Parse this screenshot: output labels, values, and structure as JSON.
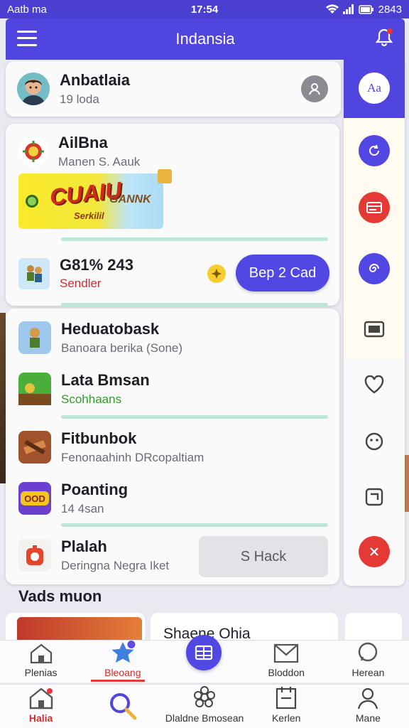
{
  "status": {
    "left": "Aatb ma",
    "time": "17:54",
    "battery": "2843"
  },
  "header": {
    "title": "Indansia"
  },
  "profile": {
    "name": "Anbatlaia",
    "sub": "19 loda"
  },
  "feature": {
    "title": "AilBna",
    "subtitle": "Manen S. Aauk",
    "banner": {
      "main": "CUAIU",
      "side": "GANNK",
      "tag": "Serkilil"
    },
    "stat_value": "G81% 243",
    "stat_sub": "Sendler",
    "progress_top": 1.0,
    "progress_bottom": 1.0,
    "button": "Bep 2 Cad"
  },
  "list": [
    {
      "title": "Heduatobask",
      "sub": "Banoara berika (Sone)",
      "color": "#9ec9ec"
    },
    {
      "title": "Lata Bmsan",
      "sub": "Scohhaans",
      "sub_green": true,
      "color": "#4aae3a"
    },
    {
      "title": "Fitbunbok",
      "sub": "Fenonaahinh DRcopaltiam",
      "color": "#a0522d"
    },
    {
      "title": "Poanting",
      "sub": "14 4san",
      "color": "#6b3fcf"
    },
    {
      "title": "Plalah",
      "sub": "Deringna Negra Iket",
      "color": "#f4f2ef"
    }
  ],
  "list_button": "S Hack",
  "section": {
    "title": "Vads muon",
    "card_title": "Shaene Ohia"
  },
  "sidebar": {
    "top_label": "Aa"
  },
  "nav_top": [
    {
      "label": "Plenias"
    },
    {
      "label": "Bleoang"
    },
    {
      "label": ""
    },
    {
      "label": "Bloddon"
    },
    {
      "label": "Herean"
    }
  ],
  "nav_bottom": [
    {
      "label": "Halia"
    },
    {
      "label": ""
    },
    {
      "label": "Dlaldne Bmosean"
    },
    {
      "label": "Kerlen"
    },
    {
      "label": "Mane"
    }
  ],
  "colors": {
    "accent": "#5145e0",
    "danger": "#e53935",
    "success": "#2f9b2a"
  }
}
